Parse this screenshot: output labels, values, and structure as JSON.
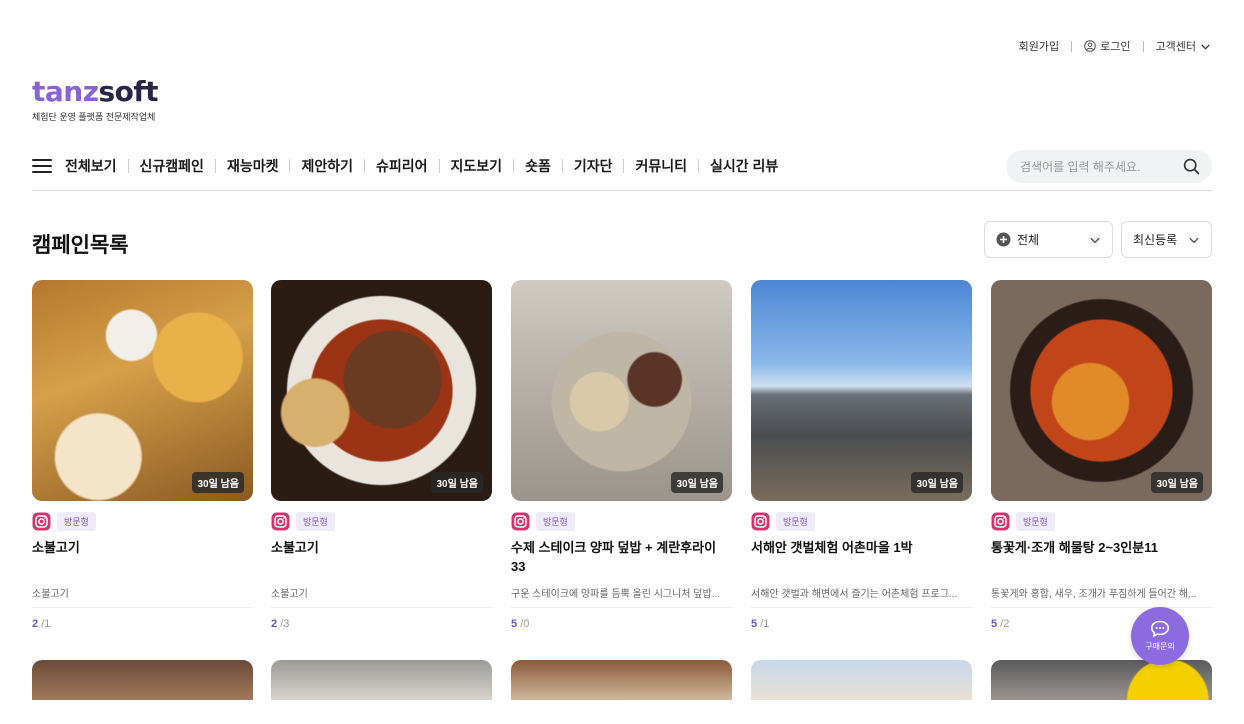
{
  "util_nav": {
    "signup": "회원가입",
    "login": "로그인",
    "support": "고객센터"
  },
  "logo": {
    "part1": "tanz",
    "part2": "soft",
    "tagline": "체험단 운영 플랫폼 전문제작업체"
  },
  "nav": {
    "items": [
      {
        "label": "전체보기"
      },
      {
        "label": "신규캠페인"
      },
      {
        "label": "재능마켓"
      },
      {
        "label": "제안하기"
      },
      {
        "label": "슈피리어"
      },
      {
        "label": "지도보기"
      },
      {
        "label": "숏폼"
      },
      {
        "label": "기자단"
      },
      {
        "label": "커뮤니티"
      },
      {
        "label": "실시간 리뷰"
      }
    ]
  },
  "search": {
    "placeholder": "검색어를 입력 해주세요."
  },
  "page_title": "캠페인목록",
  "filters": {
    "category": "전체",
    "sort": "최신등록"
  },
  "campaigns": [
    {
      "days_left": "30일 남음",
      "type": "방문형",
      "title": "소불고기",
      "desc": "소불고기",
      "applied": "2",
      "total": "/1"
    },
    {
      "days_left": "30일 남음",
      "type": "방문형",
      "title": "소불고기",
      "desc": "소불고기",
      "applied": "2",
      "total": "/3"
    },
    {
      "days_left": "30일 남음",
      "type": "방문형",
      "title": "수제 스테이크 양파 덮밥 + 계란후라이 33",
      "desc": "구운 스테이크에 양파를 듬뿍 올린 시그니처 덮밥...",
      "applied": "5",
      "total": "/0"
    },
    {
      "days_left": "30일 남음",
      "type": "방문형",
      "title": "서해안 갯벌체험 어촌마을 1박",
      "desc": "서해안 갯벌과 해변에서 즐기는 어촌체험 프로그...",
      "applied": "5",
      "total": "/1"
    },
    {
      "days_left": "30일 남음",
      "type": "방문형",
      "title": "통꽃게·조개 해물탕 2~3인분11",
      "desc": "통꽃게와 홍합, 새우, 조개가 푸짐하게 들어간 해...",
      "applied": "5",
      "total": "/2"
    }
  ],
  "chat": {
    "label": "구매문의"
  },
  "colors": {
    "brand_purple": "#8a63d2",
    "brand_dark": "#2a2446",
    "count_accent": "#6a54c7"
  }
}
